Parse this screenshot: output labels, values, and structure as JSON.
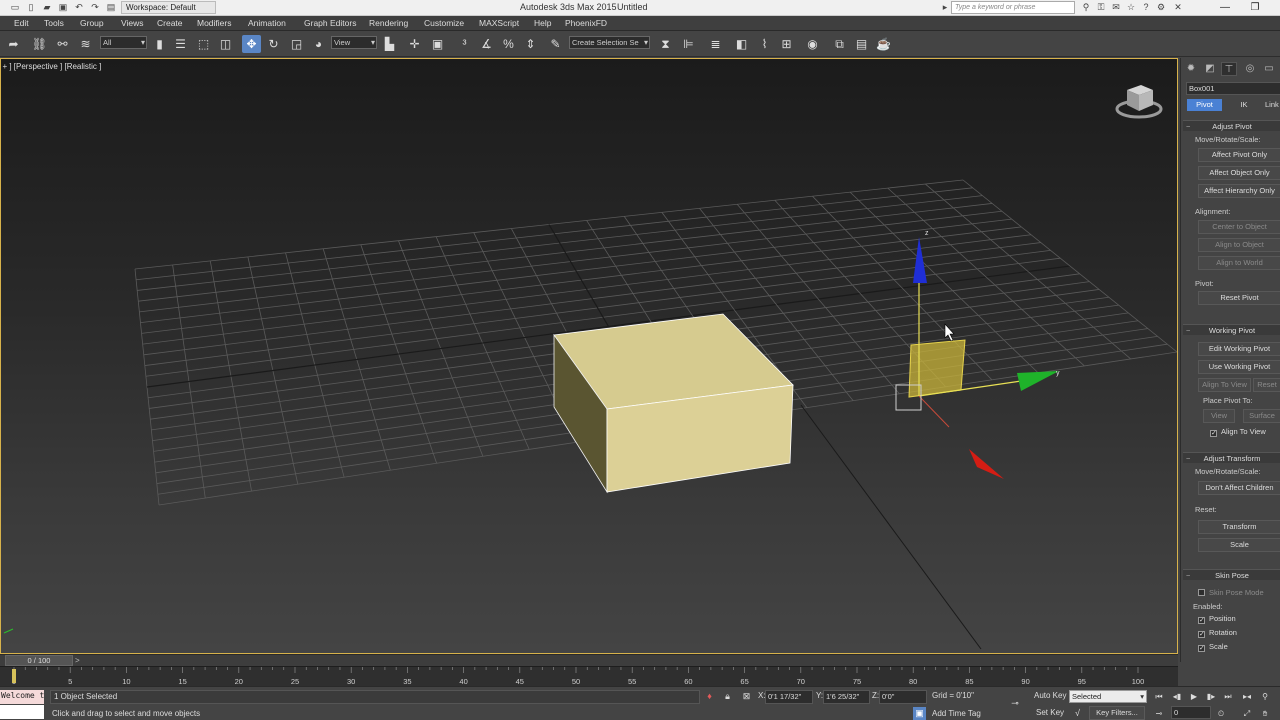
{
  "titlebar": {
    "workspace": "Workspace: Default",
    "app_title": "Autodesk 3ds Max  2015",
    "doc_title": "Untitled",
    "search_placeholder": "Type a keyword or phrase",
    "min": "—",
    "restore": "❐",
    "close": "✕"
  },
  "menu": [
    "Edit",
    "Tools",
    "Group",
    "Views",
    "Create",
    "Modifiers",
    "Animation",
    "Graph Editors",
    "Rendering",
    "Customize",
    "MAXScript",
    "Help",
    "PhoenixFD"
  ],
  "toolbar": {
    "selection_filter": "All",
    "ref_coord": "View",
    "named_selection": "Create Selection Se"
  },
  "viewport": {
    "label": "[ + ] [Perspective ] [Realistic ]",
    "gizmo_axis_z": "z",
    "gizmo_axis_y": "y"
  },
  "command_panel": {
    "object_name": "Box001",
    "subtabs": [
      "Pivot",
      "IK",
      "Link Info"
    ],
    "adjust_pivot": {
      "title": "Adjust Pivot",
      "move_label": "Move/Rotate/Scale:",
      "affect_pivot": "Affect Pivot Only",
      "affect_object": "Affect Object Only",
      "affect_hierarchy": "Affect Hierarchy Only",
      "alignment_label": "Alignment:",
      "center_to_object": "Center to Object",
      "align_to_object": "Align to Object",
      "align_to_world": "Align to World",
      "pivot_label": "Pivot:",
      "reset_pivot": "Reset Pivot"
    },
    "working_pivot": {
      "title": "Working Pivot",
      "edit": "Edit Working Pivot",
      "use": "Use Working Pivot",
      "align_to_view": "Align To View",
      "reset": "Reset",
      "place_label": "Place Pivot To:",
      "view": "View",
      "surface": "Surface",
      "align_chk": "Align To View"
    },
    "adjust_transform": {
      "title": "Adjust Transform",
      "move_label": "Move/Rotate/Scale:",
      "dont_affect": "Don't Affect Children",
      "reset_label": "Reset:",
      "transform": "Transform",
      "scale": "Scale"
    },
    "skin_pose": {
      "title": "Skin Pose",
      "mode": "Skin Pose Mode",
      "enabled_label": "Enabled:",
      "position": "Position",
      "rotation": "Rotation",
      "scale": "Scale"
    }
  },
  "timeline": {
    "frame_label": "0 / 100",
    "next": ">",
    "ticks": [
      "0",
      "5",
      "10",
      "15",
      "20",
      "25",
      "30",
      "35",
      "40",
      "45",
      "50",
      "55",
      "60",
      "65",
      "70",
      "75",
      "80",
      "85",
      "90",
      "95",
      "100"
    ]
  },
  "status": {
    "maxscript": "Welcome to M",
    "selected": "1 Object Selected",
    "prompt": "Click and drag to select and move objects",
    "x_label": "X:",
    "x_value": "0'1 17/32\"",
    "y_label": "Y:",
    "y_value": "1'6 25/32\"",
    "z_label": "Z:",
    "z_value": "0'0\"",
    "grid": "Grid = 0'10\"",
    "add_time_tag": "Add Time Tag",
    "auto_key": "Auto Key",
    "set_key": "Set Key",
    "selected_dropdown": "Selected",
    "key_filters": "Key Filters...",
    "frame": "0"
  }
}
